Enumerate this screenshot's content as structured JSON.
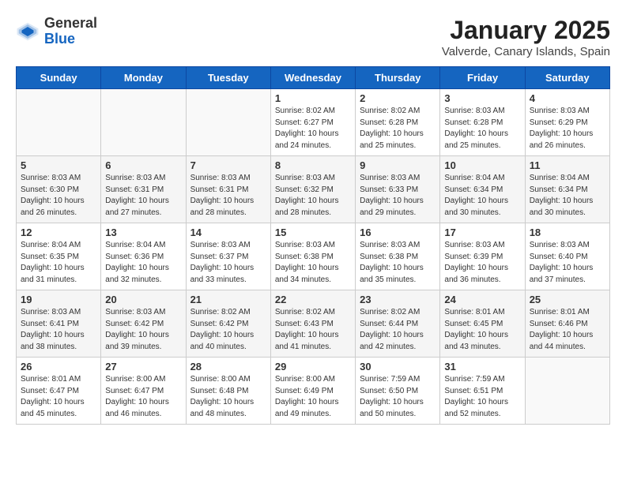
{
  "logo": {
    "general": "General",
    "blue": "Blue"
  },
  "title": "January 2025",
  "subtitle": "Valverde, Canary Islands, Spain",
  "weekdays": [
    "Sunday",
    "Monday",
    "Tuesday",
    "Wednesday",
    "Thursday",
    "Friday",
    "Saturday"
  ],
  "weeks": [
    [
      {
        "day": "",
        "info": ""
      },
      {
        "day": "",
        "info": ""
      },
      {
        "day": "",
        "info": ""
      },
      {
        "day": "1",
        "info": "Sunrise: 8:02 AM\nSunset: 6:27 PM\nDaylight: 10 hours\nand 24 minutes."
      },
      {
        "day": "2",
        "info": "Sunrise: 8:02 AM\nSunset: 6:28 PM\nDaylight: 10 hours\nand 25 minutes."
      },
      {
        "day": "3",
        "info": "Sunrise: 8:03 AM\nSunset: 6:28 PM\nDaylight: 10 hours\nand 25 minutes."
      },
      {
        "day": "4",
        "info": "Sunrise: 8:03 AM\nSunset: 6:29 PM\nDaylight: 10 hours\nand 26 minutes."
      }
    ],
    [
      {
        "day": "5",
        "info": "Sunrise: 8:03 AM\nSunset: 6:30 PM\nDaylight: 10 hours\nand 26 minutes."
      },
      {
        "day": "6",
        "info": "Sunrise: 8:03 AM\nSunset: 6:31 PM\nDaylight: 10 hours\nand 27 minutes."
      },
      {
        "day": "7",
        "info": "Sunrise: 8:03 AM\nSunset: 6:31 PM\nDaylight: 10 hours\nand 28 minutes."
      },
      {
        "day": "8",
        "info": "Sunrise: 8:03 AM\nSunset: 6:32 PM\nDaylight: 10 hours\nand 28 minutes."
      },
      {
        "day": "9",
        "info": "Sunrise: 8:03 AM\nSunset: 6:33 PM\nDaylight: 10 hours\nand 29 minutes."
      },
      {
        "day": "10",
        "info": "Sunrise: 8:04 AM\nSunset: 6:34 PM\nDaylight: 10 hours\nand 30 minutes."
      },
      {
        "day": "11",
        "info": "Sunrise: 8:04 AM\nSunset: 6:34 PM\nDaylight: 10 hours\nand 30 minutes."
      }
    ],
    [
      {
        "day": "12",
        "info": "Sunrise: 8:04 AM\nSunset: 6:35 PM\nDaylight: 10 hours\nand 31 minutes."
      },
      {
        "day": "13",
        "info": "Sunrise: 8:04 AM\nSunset: 6:36 PM\nDaylight: 10 hours\nand 32 minutes."
      },
      {
        "day": "14",
        "info": "Sunrise: 8:03 AM\nSunset: 6:37 PM\nDaylight: 10 hours\nand 33 minutes."
      },
      {
        "day": "15",
        "info": "Sunrise: 8:03 AM\nSunset: 6:38 PM\nDaylight: 10 hours\nand 34 minutes."
      },
      {
        "day": "16",
        "info": "Sunrise: 8:03 AM\nSunset: 6:38 PM\nDaylight: 10 hours\nand 35 minutes."
      },
      {
        "day": "17",
        "info": "Sunrise: 8:03 AM\nSunset: 6:39 PM\nDaylight: 10 hours\nand 36 minutes."
      },
      {
        "day": "18",
        "info": "Sunrise: 8:03 AM\nSunset: 6:40 PM\nDaylight: 10 hours\nand 37 minutes."
      }
    ],
    [
      {
        "day": "19",
        "info": "Sunrise: 8:03 AM\nSunset: 6:41 PM\nDaylight: 10 hours\nand 38 minutes."
      },
      {
        "day": "20",
        "info": "Sunrise: 8:03 AM\nSunset: 6:42 PM\nDaylight: 10 hours\nand 39 minutes."
      },
      {
        "day": "21",
        "info": "Sunrise: 8:02 AM\nSunset: 6:42 PM\nDaylight: 10 hours\nand 40 minutes."
      },
      {
        "day": "22",
        "info": "Sunrise: 8:02 AM\nSunset: 6:43 PM\nDaylight: 10 hours\nand 41 minutes."
      },
      {
        "day": "23",
        "info": "Sunrise: 8:02 AM\nSunset: 6:44 PM\nDaylight: 10 hours\nand 42 minutes."
      },
      {
        "day": "24",
        "info": "Sunrise: 8:01 AM\nSunset: 6:45 PM\nDaylight: 10 hours\nand 43 minutes."
      },
      {
        "day": "25",
        "info": "Sunrise: 8:01 AM\nSunset: 6:46 PM\nDaylight: 10 hours\nand 44 minutes."
      }
    ],
    [
      {
        "day": "26",
        "info": "Sunrise: 8:01 AM\nSunset: 6:47 PM\nDaylight: 10 hours\nand 45 minutes."
      },
      {
        "day": "27",
        "info": "Sunrise: 8:00 AM\nSunset: 6:47 PM\nDaylight: 10 hours\nand 46 minutes."
      },
      {
        "day": "28",
        "info": "Sunrise: 8:00 AM\nSunset: 6:48 PM\nDaylight: 10 hours\nand 48 minutes."
      },
      {
        "day": "29",
        "info": "Sunrise: 8:00 AM\nSunset: 6:49 PM\nDaylight: 10 hours\nand 49 minutes."
      },
      {
        "day": "30",
        "info": "Sunrise: 7:59 AM\nSunset: 6:50 PM\nDaylight: 10 hours\nand 50 minutes."
      },
      {
        "day": "31",
        "info": "Sunrise: 7:59 AM\nSunset: 6:51 PM\nDaylight: 10 hours\nand 52 minutes."
      },
      {
        "day": "",
        "info": ""
      }
    ]
  ]
}
